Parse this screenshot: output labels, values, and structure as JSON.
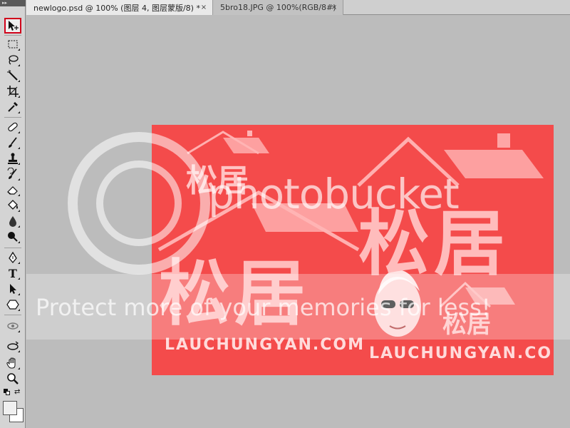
{
  "tabs": [
    {
      "label": "newlogo.psd @ 100% (图层 4, 图层蒙版/8) *",
      "active": true
    },
    {
      "label": "5bro18.JPG @ 100%(RGB/8#)",
      "active": false
    }
  ],
  "tab_close_glyph": "×",
  "toolbar": {
    "grip_glyph": "▸▸",
    "tools": [
      {
        "name": "move-tool",
        "icon": "move-icon",
        "selected": true
      },
      {
        "name": "marquee-tool",
        "icon": "marquee-icon"
      },
      {
        "name": "lasso-tool",
        "icon": "lasso-icon"
      },
      {
        "name": "quick-select-tool",
        "icon": "magic-wand-icon"
      },
      {
        "name": "crop-tool",
        "icon": "crop-icon"
      },
      {
        "name": "eyedropper-tool",
        "icon": "eyedropper-icon"
      },
      {
        "name": "healing-brush-tool",
        "icon": "bandage-icon"
      },
      {
        "name": "brush-tool",
        "icon": "brush-icon"
      },
      {
        "name": "clone-stamp-tool",
        "icon": "stamp-icon"
      },
      {
        "name": "history-brush-tool",
        "icon": "history-brush-icon"
      },
      {
        "name": "eraser-tool",
        "icon": "eraser-icon"
      },
      {
        "name": "paint-bucket-tool",
        "icon": "paint-bucket-icon"
      },
      {
        "name": "blur-tool",
        "icon": "droplet-icon"
      },
      {
        "name": "dodge-tool",
        "icon": "dodge-icon"
      },
      {
        "name": "pen-tool",
        "icon": "pen-icon"
      },
      {
        "name": "type-tool",
        "icon": "type-icon",
        "glyph": "T"
      },
      {
        "name": "path-select-tool",
        "icon": "arrow-icon"
      },
      {
        "name": "shape-tool",
        "icon": "hexagon-icon"
      },
      {
        "name": "3d-rotate-tool",
        "icon": "3d-rotate-icon"
      },
      {
        "name": "3d-orbit-tool",
        "icon": "3d-orbit-icon"
      },
      {
        "name": "hand-tool",
        "icon": "hand-icon"
      },
      {
        "name": "zoom-tool",
        "icon": "zoom-icon"
      }
    ]
  },
  "colors": {
    "artwork_red": "#f44b4b",
    "selected_tool_border": "#d0021b",
    "foreground": "#f0f0f0",
    "background": "#ffffff"
  },
  "artwork": {
    "brand_chinese": "松居",
    "brand_url": "LAUCHUNGYAN.COM"
  },
  "watermark": {
    "brand": "photobucket",
    "tagline": "Protect more of your memories for less!"
  }
}
